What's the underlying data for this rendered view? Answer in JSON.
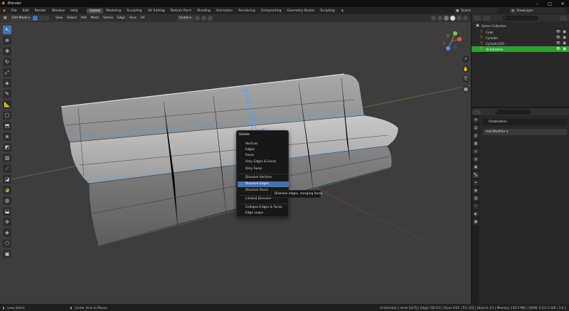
{
  "window": {
    "title": "Blender"
  },
  "menu": [
    "File",
    "Edit",
    "Render",
    "Window",
    "Help"
  ],
  "workspaces": [
    {
      "label": "Layout",
      "active": true
    },
    {
      "label": "Modeling"
    },
    {
      "label": "Sculpting"
    },
    {
      "label": "UV Editing"
    },
    {
      "label": "Texture Paint"
    },
    {
      "label": "Shading"
    },
    {
      "label": "Animation"
    },
    {
      "label": "Rendering"
    },
    {
      "label": "Compositing"
    },
    {
      "label": "Geometry Nodes"
    },
    {
      "label": "Scripting"
    }
  ],
  "scene": {
    "name": "Scene",
    "view_layer": "ViewLayer"
  },
  "viewport_header": {
    "mode": "Edit Mode",
    "menus": [
      "View",
      "Select",
      "Add",
      "Mesh",
      "Vertex",
      "Edge",
      "Face",
      "UV"
    ],
    "transform_orientation": "Global"
  },
  "context_menu": {
    "title": "Delete",
    "items": [
      {
        "label": "Vertices"
      },
      {
        "label": "Edges"
      },
      {
        "label": "Faces"
      },
      {
        "label": "Only Edges & Faces"
      },
      {
        "label": "Only Faces"
      },
      {
        "label": "Dissolve Vertices"
      },
      {
        "label": "Dissolve Edges",
        "highlighted": true
      },
      {
        "label": "Dissolve Faces"
      },
      {
        "label": "Limited Dissolve"
      },
      {
        "label": "Collapse Edges & Faces"
      },
      {
        "label": "Edge Loops"
      }
    ],
    "tooltip": "Dissolve edges, merging faces."
  },
  "outliner": {
    "collection": "Scene Collection",
    "objects": [
      {
        "name": "Cube"
      },
      {
        "name": "Cylinder"
      },
      {
        "name": "Cylinder.001"
      },
      {
        "name": "Octahedron",
        "selected": true
      }
    ]
  },
  "properties": {
    "object_name": "Octahedron",
    "add_modifier": "Add Modifier"
  },
  "status": {
    "left_items": [
      "Loop Select",
      "Center View to Mouse"
    ],
    "right": "Octahedron | Verts 54/70 | Edges 56/110 | Faces 0/42 | Tris 102 | Objects 1/1 | Memory: 239.5 MiB | VRAM: 0.5/2.0 GiB | 3.6.1"
  },
  "colors": {
    "accent": "#4772b3",
    "selected_row": "#2e9e2e",
    "brand": "#e87d0d"
  }
}
